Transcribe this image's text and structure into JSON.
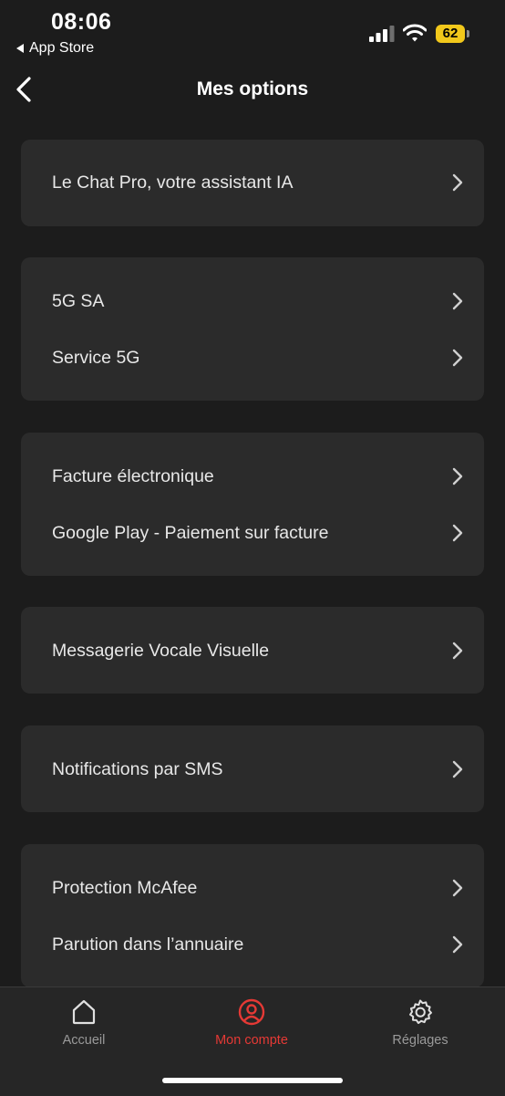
{
  "status_bar": {
    "time": "08:06",
    "back_app": "App Store",
    "battery": "62",
    "battery_color": "#f2c81b"
  },
  "header": {
    "title": "Mes options"
  },
  "sections": [
    {
      "items": [
        {
          "label": "Le Chat Pro, votre assistant IA"
        }
      ]
    },
    {
      "items": [
        {
          "label": "5G SA"
        },
        {
          "label": "Service 5G"
        }
      ]
    },
    {
      "items": [
        {
          "label": "Facture électronique"
        },
        {
          "label": "Google Play - Paiement sur facture"
        }
      ]
    },
    {
      "items": [
        {
          "label": "Messagerie Vocale Visuelle"
        }
      ]
    },
    {
      "items": [
        {
          "label": "Notifications par SMS"
        }
      ]
    },
    {
      "items": [
        {
          "label": "Protection McAfee"
        },
        {
          "label": "Parution dans l’annuaire"
        }
      ]
    }
  ],
  "tabbar": {
    "tabs": [
      {
        "label": "Accueil",
        "icon": "home-icon"
      },
      {
        "label": "Mon compte",
        "icon": "account-icon",
        "active": true
      },
      {
        "label": "Réglages",
        "icon": "gear-icon"
      }
    ],
    "active_color": "#e53935"
  }
}
